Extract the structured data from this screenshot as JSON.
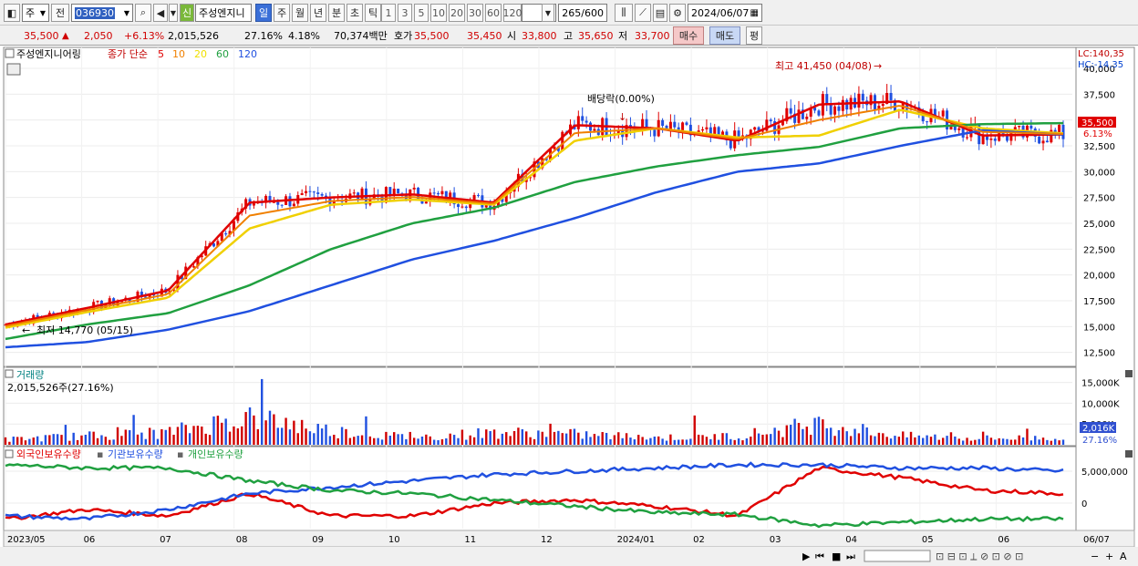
{
  "toolbar": {
    "market_select": "주",
    "prev_label": "전",
    "code": "036930",
    "stock_badge": "신",
    "stock_name": "주성엔지니",
    "periods": [
      "일",
      "주",
      "월",
      "년",
      "분",
      "초",
      "틱"
    ],
    "active_period": "일",
    "intervals": [
      "1",
      "3",
      "5",
      "10",
      "20",
      "30",
      "60",
      "120"
    ],
    "count": "265",
    "count_max": "/600",
    "date": "2024/06/07"
  },
  "quote": {
    "price": "35,500",
    "change": "2,050",
    "change_pct": "+6.13%",
    "volume": "2,015,526",
    "turnover": "27.16%",
    "ratio": "4.18%",
    "amount": "70,374백만",
    "ask_label": "호가",
    "ask1": "35,500",
    "ask2": "35,450",
    "open_label": "시",
    "open": "33,800",
    "high_label": "고",
    "high": "35,650",
    "low_label": "저",
    "low": "33,700",
    "buy": "매수",
    "sell": "매도",
    "avg": "평"
  },
  "price_panel": {
    "legend_name": "주성엔지니어링",
    "legend_ma": "종가 단순",
    "ma_periods": [
      "5",
      "10",
      "20",
      "60",
      "120"
    ],
    "ma_colors": [
      "#e00000",
      "#f08000",
      "#f0e000",
      "#20a040",
      "#2050e0"
    ],
    "lc_label": "LC:140,35",
    "hc_label": "HC:-14,35",
    "current_price": "35,500",
    "current_pct": "6.13%",
    "high_annot": "최고 41,450 (04/08)",
    "low_annot": "최저 14,770 (05/15)",
    "dividend_annot": "배당락(0.00%)",
    "y_ticks": [
      "40,000",
      "37,500",
      "35,000",
      "32,500",
      "30,000",
      "27,500",
      "25,000",
      "22,500",
      "20,000",
      "17,500",
      "15,000",
      "12,500"
    ]
  },
  "volume_panel": {
    "title": "거래량",
    "value_label": "2,015,526주(27.16%)",
    "y_ticks": [
      "15,000K",
      "10,000K",
      "5,000K"
    ],
    "current": "2,016K",
    "current_pct": "27.16%"
  },
  "holding_panel": {
    "legends": [
      "외국인보유수량",
      "기관보유수량",
      "개인보유수량"
    ],
    "colors": [
      "#e00000",
      "#2050e0",
      "#20a040"
    ],
    "y_ticks": [
      "5,000,000",
      "0"
    ]
  },
  "x_axis": {
    "labels": [
      "2023/05",
      "06",
      "07",
      "08",
      "09",
      "10",
      "11",
      "12",
      "2024/01",
      "02",
      "03",
      "04",
      "05",
      "06",
      "06/07"
    ]
  },
  "chart_data": [
    {
      "type": "line",
      "title": "주성엔지니어링",
      "x": [
        "2023/05",
        "2023/06",
        "2023/07",
        "2023/08",
        "2023/09",
        "2023/10",
        "2023/11",
        "2023/12",
        "2024/01",
        "2024/02",
        "2024/03",
        "2024/04",
        "2024/05",
        "2024/06"
      ],
      "series": [
        {
          "name": "5",
          "values": [
            15200,
            16800,
            18500,
            27000,
            27500,
            27800,
            27000,
            34500,
            34200,
            33000,
            36500,
            36800,
            33500,
            33600
          ]
        },
        {
          "name": "20",
          "values": [
            14900,
            16400,
            17800,
            24500,
            26800,
            27300,
            26800,
            33000,
            34200,
            33300,
            33500,
            36000,
            34200,
            33700
          ]
        },
        {
          "name": "60",
          "values": [
            13800,
            15200,
            16300,
            19000,
            22500,
            25000,
            26500,
            29000,
            30500,
            31600,
            32400,
            34200,
            34600,
            34700
          ]
        },
        {
          "name": "120",
          "values": [
            13000,
            13500,
            14700,
            16500,
            19000,
            21500,
            23300,
            25500,
            28000,
            30000,
            30800,
            32500,
            34000,
            33600
          ]
        }
      ],
      "ylim": [
        11500,
        41500
      ]
    },
    {
      "type": "bar",
      "title": "거래량",
      "x": [
        "2023/05",
        "2023/06",
        "2023/07",
        "2023/08",
        "2023/09",
        "2023/10",
        "2023/11",
        "2023/12",
        "2024/01",
        "2024/02",
        "2024/03",
        "2024/04",
        "2024/05",
        "2024/06"
      ],
      "values": [
        1500,
        2500,
        3500,
        8000,
        4000,
        2000,
        3500,
        3000,
        2000,
        2500,
        6000,
        2500,
        1800,
        2016
      ],
      "ylim": [
        0,
        16000
      ]
    },
    {
      "type": "line",
      "title": "보유수량",
      "x": [
        "2023/05",
        "2023/06",
        "2023/07",
        "2023/08",
        "2023/09",
        "2023/10",
        "2023/11",
        "2023/12",
        "2024/01",
        "2024/02",
        "2024/03",
        "2024/04",
        "2024/05",
        "2024/06"
      ],
      "series": [
        {
          "name": "외국인보유수량",
          "values": [
            -2500000,
            -1000000,
            -2000000,
            1500000,
            -2000000,
            -2000000,
            0,
            500000,
            -500000,
            -2000000,
            5500000,
            4000000,
            2000000,
            1500000
          ]
        },
        {
          "name": "기관보유수량",
          "values": [
            -2000000,
            -2500000,
            -1000000,
            1500000,
            2500000,
            3500000,
            4500000,
            5000000,
            5500000,
            6000000,
            6000000,
            5500000,
            5500000,
            5000000
          ]
        },
        {
          "name": "개인보유수량",
          "values": [
            6000000,
            5500000,
            5500000,
            3500000,
            2000000,
            1500000,
            500000,
            -500000,
            -1500000,
            -1800000,
            -3500000,
            -3000000,
            -2500000,
            -2500000
          ]
        }
      ],
      "ylim": [
        -4000000,
        8000000
      ]
    }
  ]
}
